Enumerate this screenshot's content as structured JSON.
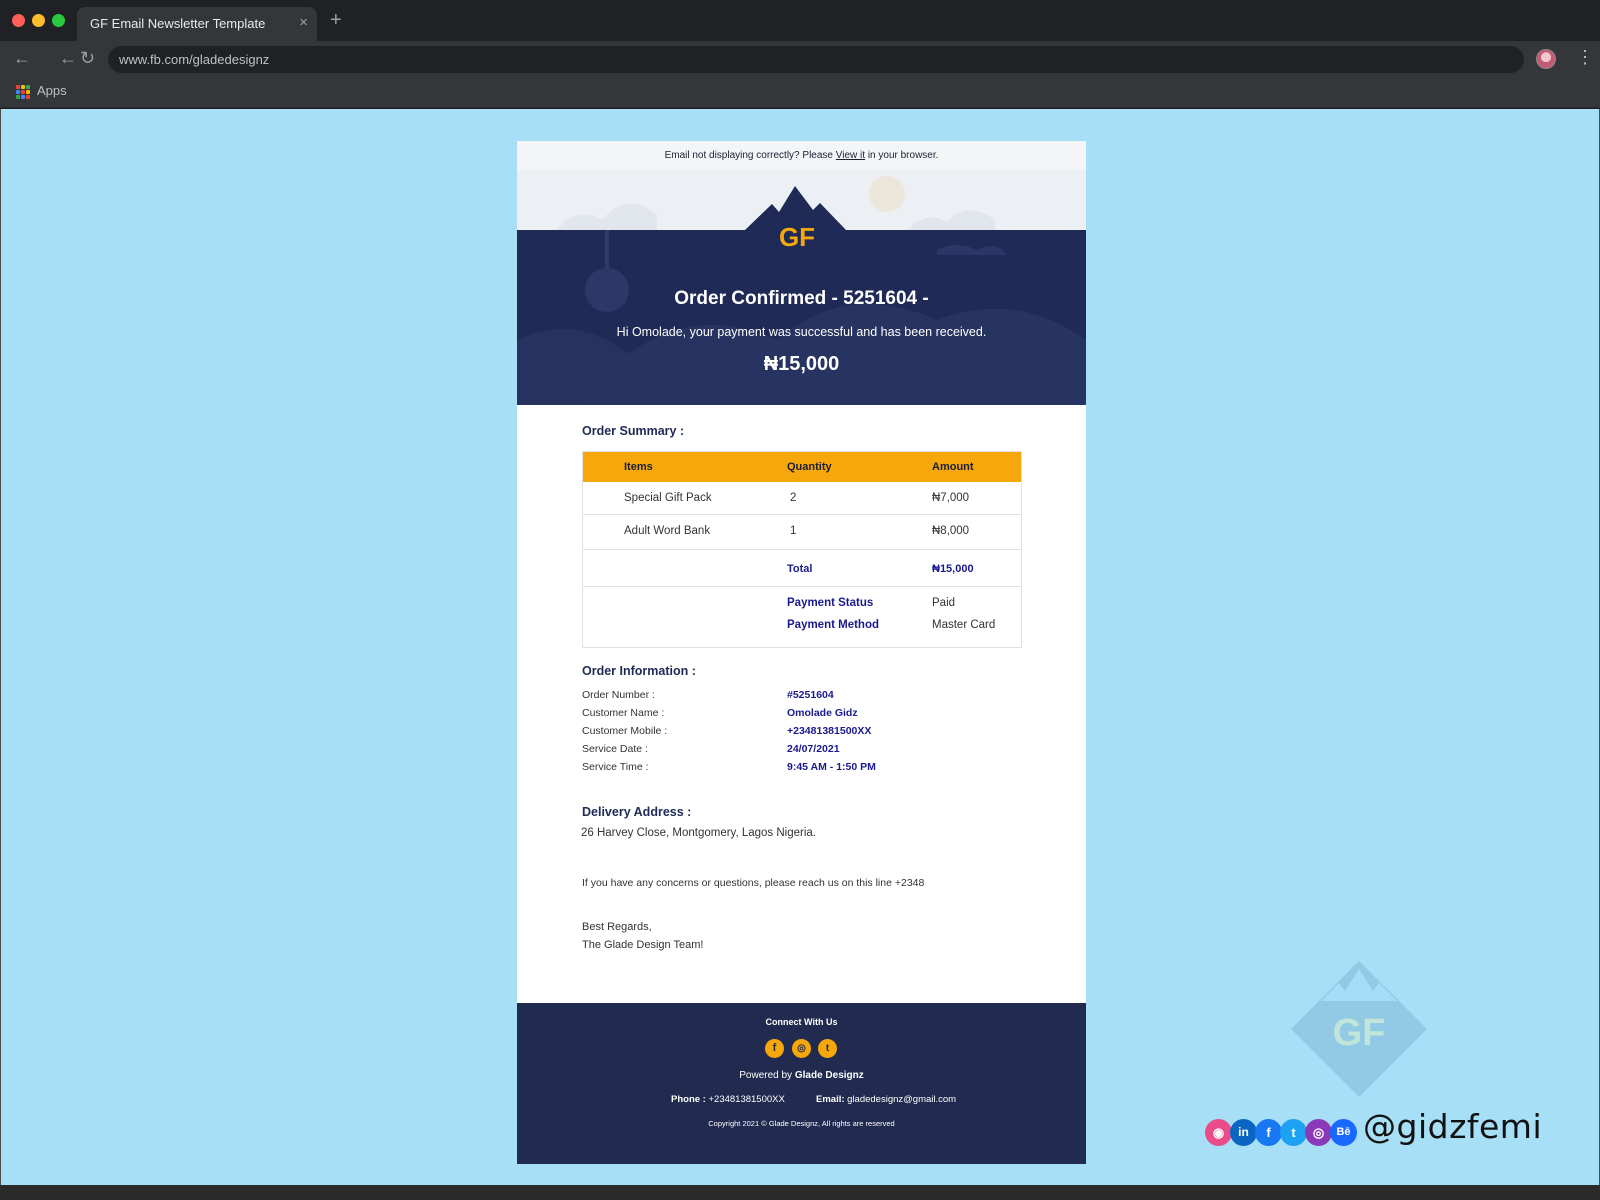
{
  "browser": {
    "tab_title": "GF Email Newsletter Template",
    "tab_close": "×",
    "new_tab": "+",
    "url": "www.fb.com/gladedesignz",
    "bookmarks_label": "Apps",
    "back_icon": "←",
    "forward_icon": "←",
    "reload_icon": "↻",
    "menu_icon": "⋮"
  },
  "email": {
    "preheader_text": "Email not displaying correctly? Please ",
    "preheader_link": "View it",
    "preheader_suffix": " in your browser.",
    "logo": "GF",
    "title": "Order Confirmed - 5251604 -",
    "greeting": "Hi Omolade, your payment was successful and has been received.",
    "amount": "₦15,000",
    "order_summary_title": "Order Summary :",
    "table": {
      "headers": [
        "Items",
        "Quantity",
        "Amount"
      ],
      "rows": [
        {
          "item": "Special Gift Pack",
          "quantity": "2",
          "amount": "₦7,000"
        },
        {
          "item": "Adult Word Bank",
          "quantity": "1",
          "amount": "₦8,000"
        }
      ],
      "total_label": "Total",
      "total_value": "₦15,000",
      "payment_status_label": "Payment Status",
      "payment_status_value": "Paid",
      "payment_method_label": "Payment Method",
      "payment_method_value": "Master Card"
    },
    "order_info_title": "Order Information :",
    "order_info": [
      {
        "label": "Order Number :",
        "value": "#5251604"
      },
      {
        "label": "Customer Name :",
        "value": "Omolade Gidz"
      },
      {
        "label": "Customer Mobile :",
        "value": "+23481381500XX"
      },
      {
        "label": "Service Date :",
        "value": "24/07/2021"
      },
      {
        "label": "Service Time :",
        "value": "9:45 AM - 1:50 PM"
      }
    ],
    "delivery_title": "Delivery Address :",
    "delivery_address": "26 Harvey Close, Montgomery, Lagos Nigeria.",
    "concerns": "If you have any concerns or questions, please reach us on this line +2348",
    "regards": "Best Regards,",
    "team": "The Glade Design Team!",
    "footer": {
      "connect": "Connect With Us",
      "social_icons": [
        "facebook-icon",
        "instagram-icon",
        "twitter-icon"
      ],
      "powered_prefix": "Powered by ",
      "powered_brand": "Glade Designz",
      "phone_label": "Phone :",
      "phone_value": " +23481381500XX",
      "email_label": "Email:",
      "email_value": " gladedesignz@gmail.com",
      "copyright": "Copyright 2021 © Glade Designz, All rights are reserved"
    }
  },
  "watermark": {
    "logo": "GF",
    "handle": "@gidzfemi",
    "social_icons": [
      "dribbble-icon",
      "linkedin-icon",
      "facebook-icon",
      "twitter-icon",
      "instagram-icon",
      "behance-icon"
    ]
  },
  "colors": {
    "page_bg": "#a6dff6",
    "navy": "#1f2a56",
    "accent": "#f5a70b",
    "link_blue": "#1a1a8f"
  }
}
